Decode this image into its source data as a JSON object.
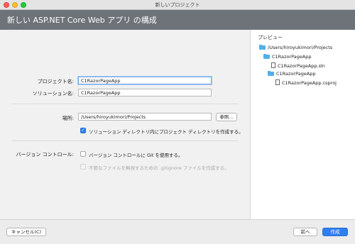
{
  "window": {
    "title": "新しいプロジェクト"
  },
  "header": {
    "title": "新しい ASP.NET Core Web アプリ の構成"
  },
  "form": {
    "project_name_label": "プロジェクト名:",
    "project_name_value": "C1RazorPageApp",
    "solution_name_label": "ソリューション名:",
    "solution_name_value": "C1RazorPageApp",
    "location_label": "場所:",
    "location_value": "/Users/hiroyukimori/Projects",
    "browse_label": "参照...",
    "create_dir_label": "ソリューション ディレクトリ内にプロジェクト ディレクトリを作成する。",
    "create_dir_checked": true,
    "vcs_label": "バージョン コントロール:",
    "git_label": "バージョン コントロールに Git を使用する。",
    "git_checked": false,
    "gitignore_label": "不要なファイルを無視するための .gitignore ファイルを作成する。",
    "gitignore_checked": false
  },
  "preview": {
    "title": "プレビュー",
    "items": [
      {
        "label": "/Users/hiroyukimori/Projects",
        "icon": "folder-icon"
      },
      {
        "label": "C1RazorPageApp",
        "icon": "folder-icon"
      },
      {
        "label": "C1RazorPageApp.sln",
        "icon": "file-icon"
      },
      {
        "label": "C1RazorPageApp",
        "icon": "folder-icon"
      },
      {
        "label": "C1RazorPageApp.csproj",
        "icon": "file-icon"
      }
    ]
  },
  "footer": {
    "cancel_label": "キャンセル(C)",
    "back_label": "前へ",
    "create_label": "作成"
  },
  "colors": {
    "header": "#6e7379",
    "accent": "#2f7ff0",
    "folder": "#4fb0e8"
  }
}
